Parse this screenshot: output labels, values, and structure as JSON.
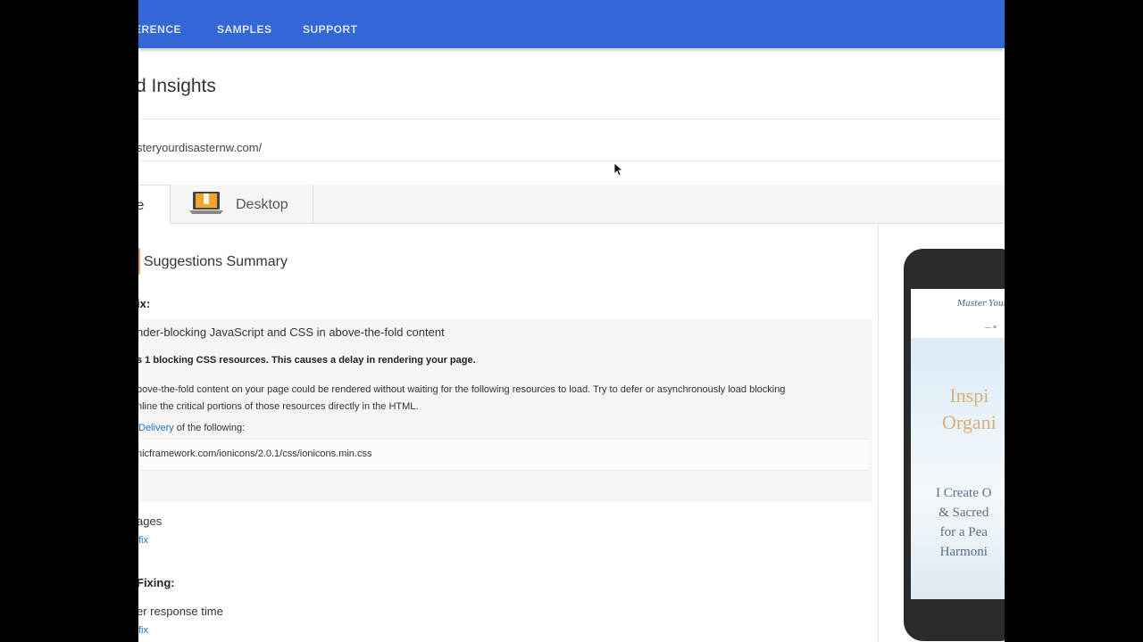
{
  "nav": {
    "items": [
      {
        "label": "ERENCE"
      },
      {
        "label": "SAMPLES"
      },
      {
        "label": "SUPPORT"
      }
    ]
  },
  "page": {
    "title": "d Insights",
    "url": "steryourdisasternw.com/"
  },
  "tabs": {
    "mobile": "le",
    "desktop": "Desktop"
  },
  "results": {
    "summary_title": "Suggestions Summary",
    "should_fix_heading": "ix:",
    "rule1": {
      "title": "nder-blocking JavaScript and CSS in above-the-fold content",
      "summary": "s 1 blocking CSS resources. This causes a delay in rendering your page.",
      "desc_line1": "bove-the-fold content on your page could be rendered without waiting for the following resources to load. Try to defer or asynchronously load blocking",
      "desc_line2": "nline the critical portions of those resources directly in the HTML.",
      "link_text": "Delivery",
      "link_suffix": " of the following:",
      "resource": "nicframework.com/ionicons/2.0.1/css/ionicons.min.css"
    },
    "rule2": {
      "title": "ages",
      "fix_link": "fix"
    },
    "consider_heading": "Fixing:",
    "rule3": {
      "title": "er response time",
      "fix_link": "fix"
    }
  },
  "preview": {
    "site_name": "Master Your",
    "menu": "— ≡",
    "hero_line1": "Inspi",
    "hero_line2": "Organi",
    "hero_sub1": "I Create O",
    "hero_sub2": "& Sacred",
    "hero_sub3": "for a Pea",
    "hero_sub4": "Harmoni"
  },
  "colors": {
    "header": "#3367d6",
    "link": "#1a73c8",
    "badge": "#e8a05a"
  }
}
